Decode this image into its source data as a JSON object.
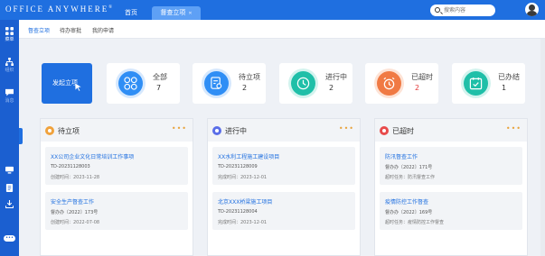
{
  "header": {
    "logo_text": "OFFICE ANYWHERE",
    "logo_mark": "®",
    "nav": [
      {
        "label": "首页"
      },
      {
        "label": "督查立项",
        "close": "✕"
      }
    ],
    "search_placeholder": "搜索内容",
    "brand_color": "#1f6fe0"
  },
  "sidebar": {
    "items": [
      {
        "label": "菜单",
        "icon": "grid-icon"
      },
      {
        "label": "组织",
        "icon": "org-icon"
      },
      {
        "label": "消息",
        "icon": "message-icon"
      },
      {
        "label": "",
        "icon": "monitor-icon"
      },
      {
        "label": "",
        "icon": "document-icon"
      },
      {
        "label": "",
        "icon": "download-icon"
      },
      {
        "label": "•••",
        "icon": "more-icon"
      }
    ]
  },
  "subtabs": [
    {
      "label": "督查立项",
      "active": true
    },
    {
      "label": "待办审批",
      "active": false
    },
    {
      "label": "我的申请",
      "active": false
    }
  ],
  "stats": {
    "launch_label": "发起立项",
    "cards": [
      {
        "name": "全部",
        "count": "7",
        "color": "#2f8ef5",
        "icon": "apps-icon"
      },
      {
        "name": "待立项",
        "count": "2",
        "color": "#2f8ef5",
        "icon": "document-search-icon"
      },
      {
        "name": "进行中",
        "count": "2",
        "color": "#1fbfa8",
        "icon": "clock-icon"
      },
      {
        "name": "已超时",
        "count": "2",
        "color": "#f07a44",
        "icon": "alarm-icon",
        "count_color": "#e23b3b"
      },
      {
        "name": "已办结",
        "count": "1",
        "color": "#1fbfa8",
        "icon": "calendar-check-icon"
      }
    ]
  },
  "columns": [
    {
      "title": "待立项",
      "dot_color": "#f0a23c",
      "more": "•••",
      "cards": [
        {
          "title": "XX公司企业文化日常培训工作事项",
          "line2": "TD-20231128003",
          "line3": "创建时间：2023-11-28"
        },
        {
          "title": "安全生产督查工作",
          "line2": "督办办〔2022〕173号",
          "line3": "创建时间：2022-07-08"
        }
      ]
    },
    {
      "title": "进行中",
      "dot_color": "#5a6ee8",
      "more": "•••",
      "cards": [
        {
          "title": "XX水利工程施工建设项目",
          "line2": "TD-20231128009",
          "line3": "完成时间：2023-12-01"
        },
        {
          "title": "北京XXX桥梁施工项目",
          "line2": "TD-20231128004",
          "line3": "完成时间：2023-12-01"
        }
      ]
    },
    {
      "title": "已超时",
      "dot_color": "#e84b4b",
      "more": "•••",
      "cards": [
        {
          "title": "防汛督查工作",
          "line2": "督办办〔2022〕171号",
          "line3": "超时任务：防汛督查工作"
        },
        {
          "title": "疫情防控工作督查",
          "line2": "督办办〔2022〕169号",
          "line3": "超时任务：疫情防控工作督查"
        }
      ]
    }
  ]
}
